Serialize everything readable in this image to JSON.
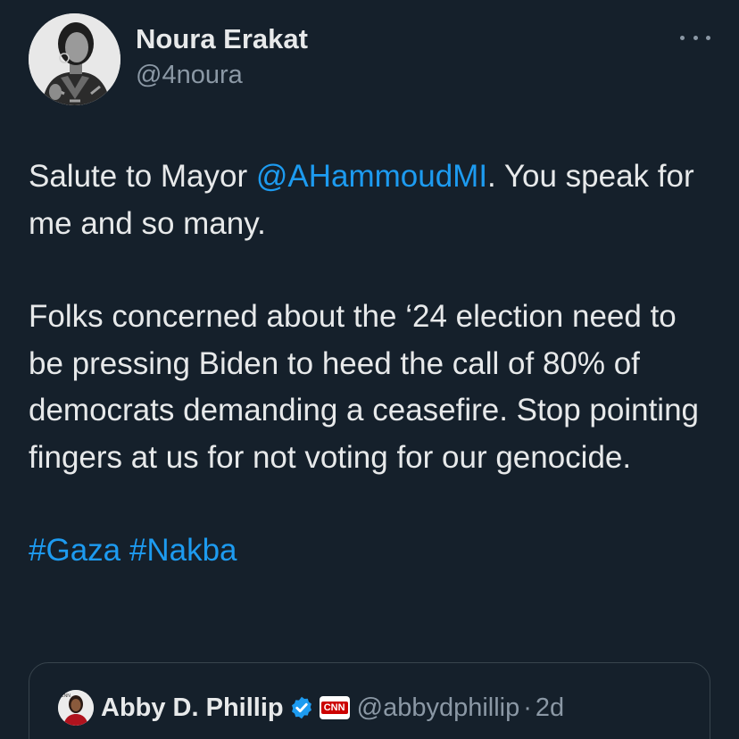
{
  "author": {
    "display_name": "Noura Erakat",
    "handle": "@4noura",
    "avatar_icon": "profile-photo",
    "more_icon": "more-horizontal-icon"
  },
  "tweet": {
    "paragraphs": [
      [
        "Salute to Mayor ",
        "@AHammoudMI",
        ". You speak for me and so many."
      ],
      [
        "Folks concerned about the ‘24 election need to be pressing Biden to heed the call of 80% of democrats demanding a ceasefire. Stop pointing fingers at us for not voting for our genocide."
      ],
      [
        "#Gaza",
        " ",
        "#Nakba"
      ]
    ],
    "mention": "@AHammoudMI",
    "hashtags": [
      "#Gaza",
      "#Nakba"
    ]
  },
  "quoted_tweet": {
    "display_name": "Abby D. Phillip",
    "verified_icon": "verified-badge-icon",
    "affiliation_logo": "CNN",
    "handle": "@abbydphillip",
    "separator": "·",
    "time": "2d"
  },
  "colors": {
    "background": "#15202b",
    "text": "#e7e9ea",
    "secondary": "#8b98a5",
    "link": "#1d9bf0",
    "border": "#38444d"
  }
}
